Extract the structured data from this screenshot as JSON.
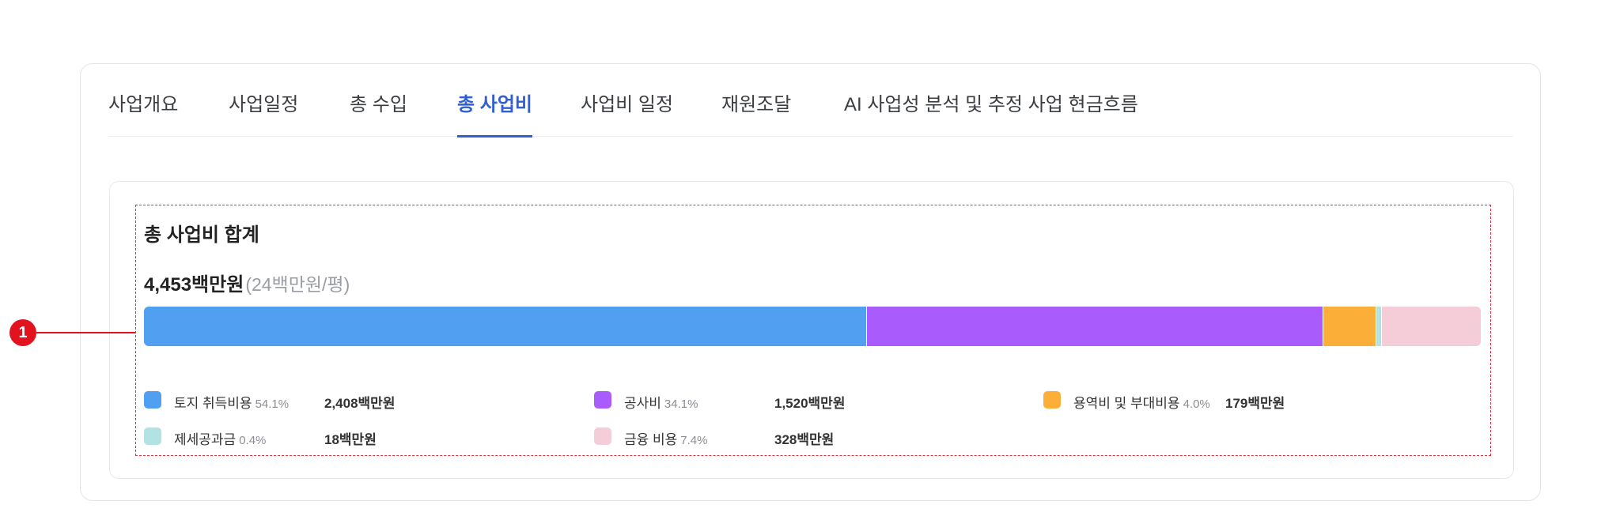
{
  "tabs": [
    {
      "label": "사업개요"
    },
    {
      "label": "사업일정"
    },
    {
      "label": "총 수입"
    },
    {
      "label": "총 사업비"
    },
    {
      "label": "사업비 일정"
    },
    {
      "label": "재원조달"
    },
    {
      "label": "AI 사업성 분석 및 추정 사업 현금흐름"
    }
  ],
  "active_tab": "총 사업비",
  "summary": {
    "title": "총 사업비 합계",
    "total": "4,453백만원",
    "per_unit": "(24백만원/평)"
  },
  "annotation": {
    "marker": "1"
  },
  "colors": {
    "accent": "#2f5fd4",
    "marker": "#e0131f"
  },
  "breakdown": [
    {
      "label": "토지 취득비용",
      "pct": "54.1%",
      "value": "2,408백만원",
      "share": 54.1,
      "color": "#519ff0"
    },
    {
      "label": "공사비",
      "pct": "34.1%",
      "value": "1,520백만원",
      "share": 34.1,
      "color": "#a95cfb"
    },
    {
      "label": "용역비 및 부대비용",
      "pct": "4.0%",
      "value": "179백만원",
      "share": 4.0,
      "color": "#fbaf38"
    },
    {
      "label": "제세공과금",
      "pct": "0.4%",
      "value": "18백만원",
      "share": 0.4,
      "color": "#b3e2e3"
    },
    {
      "label": "금융 비용",
      "pct": "7.4%",
      "value": "328백만원",
      "share": 7.4,
      "color": "#f5cdd9"
    }
  ]
}
